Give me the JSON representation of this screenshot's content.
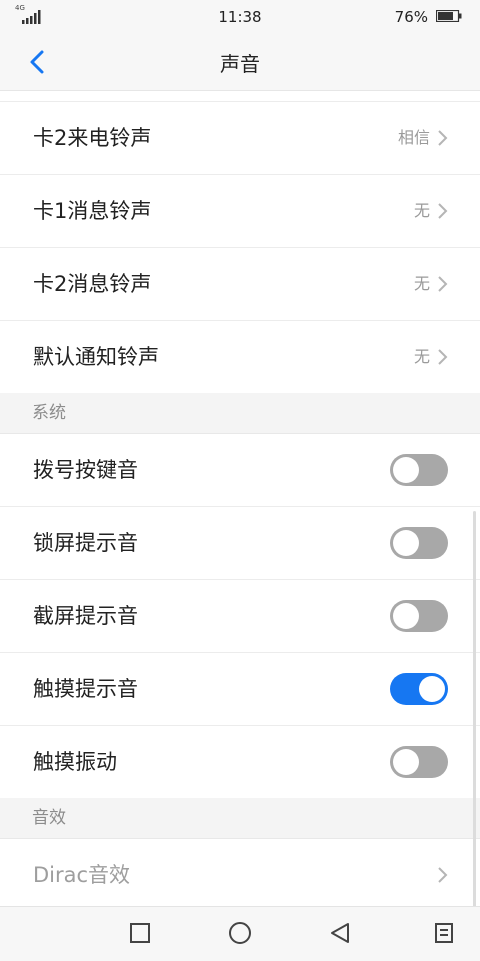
{
  "status_bar": {
    "network": "4G",
    "time": "11:38",
    "battery": "76%"
  },
  "header": {
    "title": "声音"
  },
  "rows_top": [
    {
      "label": "卡2来电铃声",
      "value": "相信"
    },
    {
      "label": "卡1消息铃声",
      "value": "无"
    },
    {
      "label": "卡2消息铃声",
      "value": "无"
    },
    {
      "label": "默认通知铃声",
      "value": "无"
    }
  ],
  "section_system": {
    "title": "系统"
  },
  "toggles": [
    {
      "label": "拨号按键音",
      "on": false
    },
    {
      "label": "锁屏提示音",
      "on": false
    },
    {
      "label": "截屏提示音",
      "on": false
    },
    {
      "label": "触摸提示音",
      "on": true
    },
    {
      "label": "触摸振动",
      "on": false
    }
  ],
  "section_effects": {
    "title": "音效"
  },
  "effects_row": {
    "label": "Dirac音效"
  },
  "colors": {
    "accent": "#1677f2",
    "toggle_off": "#a8a8a8"
  },
  "icons": {
    "back": "chevron-left-icon",
    "chevron": "chevron-right-icon",
    "nav": [
      "square-icon",
      "circle-icon",
      "triangle-back-icon",
      "menu-icon"
    ]
  }
}
